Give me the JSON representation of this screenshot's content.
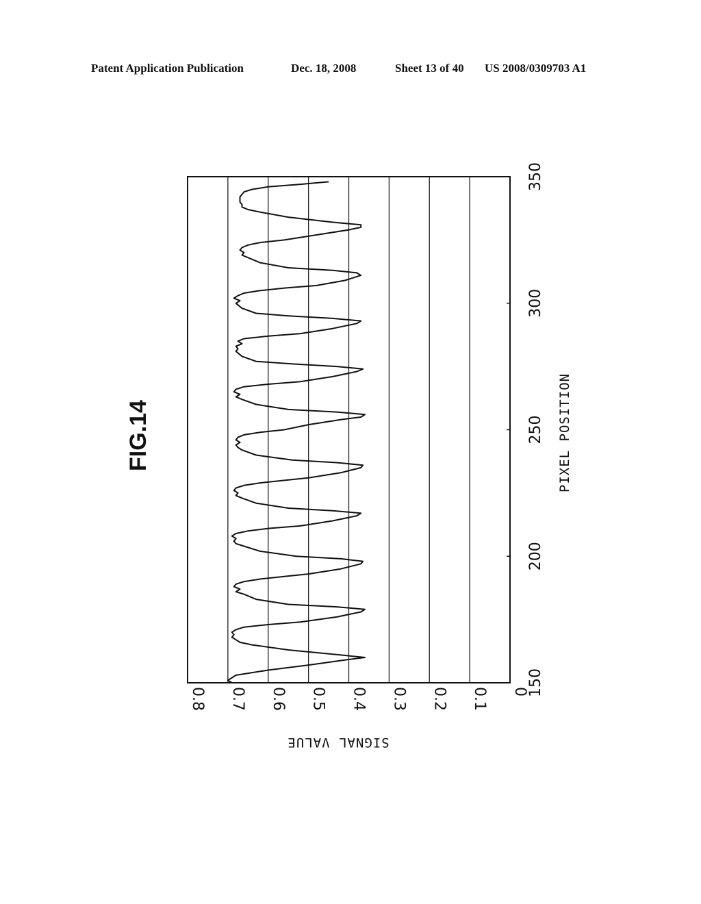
{
  "header": {
    "left": "Patent Application Publication",
    "date": "Dec. 18, 2008",
    "sheet": "Sheet 13 of 40",
    "number": "US 2008/0309703 A1"
  },
  "chart_data": {
    "type": "line",
    "title": "FIG.14",
    "xlabel": "PIXEL POSITION",
    "ylabel": "SIGNAL VALUE",
    "orientation": "rotated-90-ccw",
    "xlim": [
      150,
      350
    ],
    "ylim": [
      0,
      0.8
    ],
    "xticks": [
      "150",
      "200",
      "250",
      "300",
      "350"
    ],
    "yticks": [
      "0",
      "0.1",
      "0.2",
      "0.3",
      "0.4",
      "0.5",
      "0.6",
      "0.7",
      "0.8"
    ],
    "grid": true,
    "grid_axis": "y",
    "legend": "none",
    "series": [
      {
        "name": "signal",
        "color": "#111111",
        "x": [
          150,
          151,
          152,
          153,
          155,
          157,
          159,
          160,
          161,
          163,
          165,
          166,
          167,
          168,
          169,
          170,
          171,
          172,
          173,
          174,
          176,
          178,
          179,
          180,
          181,
          183,
          185,
          186,
          187,
          188,
          189,
          190,
          191,
          192,
          193,
          195,
          197,
          198,
          199,
          200,
          202,
          204,
          205,
          206,
          207,
          208,
          209,
          210,
          211,
          212,
          214,
          216,
          217,
          218,
          219,
          221,
          223,
          224,
          225,
          226,
          227,
          228,
          229,
          230,
          231,
          233,
          235,
          236,
          237,
          238,
          240,
          242,
          243,
          244,
          245,
          246,
          247,
          248,
          249,
          250,
          252,
          254,
          255,
          256,
          257,
          258,
          260,
          262,
          263,
          264,
          265,
          266,
          267,
          268,
          269,
          271,
          273,
          274,
          275,
          276,
          277,
          279,
          281,
          282,
          283,
          284,
          285,
          286,
          287,
          288,
          290,
          292,
          293,
          294,
          295,
          296,
          298,
          300,
          301,
          302,
          303,
          304,
          305,
          306,
          307,
          309,
          311,
          312,
          313,
          314,
          316,
          318,
          319,
          320,
          321,
          322,
          323,
          324,
          325,
          327,
          329,
          330,
          331,
          332,
          334,
          336,
          337,
          338,
          339,
          340,
          341,
          342,
          343,
          344,
          345,
          346,
          347,
          348
        ],
        "y": [
          0.69,
          0.7,
          0.69,
          0.68,
          0.6,
          0.5,
          0.41,
          0.36,
          0.42,
          0.55,
          0.64,
          0.67,
          0.68,
          0.69,
          0.685,
          0.69,
          0.68,
          0.66,
          0.6,
          0.52,
          0.43,
          0.37,
          0.36,
          0.43,
          0.55,
          0.63,
          0.66,
          0.68,
          0.67,
          0.685,
          0.68,
          0.66,
          0.62,
          0.56,
          0.5,
          0.42,
          0.37,
          0.365,
          0.42,
          0.53,
          0.62,
          0.66,
          0.68,
          0.685,
          0.68,
          0.69,
          0.68,
          0.65,
          0.6,
          0.52,
          0.44,
          0.38,
          0.37,
          0.44,
          0.55,
          0.63,
          0.665,
          0.68,
          0.675,
          0.685,
          0.68,
          0.66,
          0.62,
          0.56,
          0.5,
          0.42,
          0.37,
          0.365,
          0.43,
          0.54,
          0.63,
          0.665,
          0.675,
          0.68,
          0.67,
          0.68,
          0.675,
          0.66,
          0.62,
          0.56,
          0.5,
          0.42,
          0.37,
          0.36,
          0.43,
          0.55,
          0.63,
          0.665,
          0.68,
          0.67,
          0.685,
          0.68,
          0.66,
          0.6,
          0.52,
          0.44,
          0.38,
          0.365,
          0.43,
          0.54,
          0.63,
          0.665,
          0.68,
          0.675,
          0.68,
          0.665,
          0.675,
          0.66,
          0.6,
          0.52,
          0.44,
          0.38,
          0.37,
          0.44,
          0.55,
          0.63,
          0.665,
          0.68,
          0.67,
          0.685,
          0.675,
          0.66,
          0.62,
          0.56,
          0.48,
          0.41,
          0.37,
          0.38,
          0.44,
          0.55,
          0.62,
          0.65,
          0.665,
          0.66,
          0.67,
          0.665,
          0.65,
          0.62,
          0.56,
          0.48,
          0.4,
          0.37,
          0.37,
          0.44,
          0.55,
          0.62,
          0.65,
          0.665,
          0.665,
          0.67,
          0.67,
          0.67,
          0.665,
          0.66,
          0.64,
          0.6,
          0.52,
          0.45
        ]
      }
    ]
  }
}
